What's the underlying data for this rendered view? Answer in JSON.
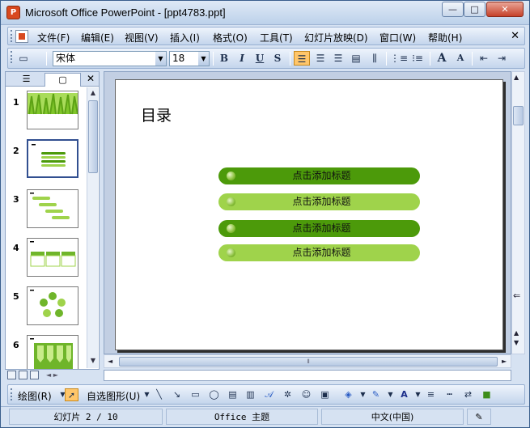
{
  "window": {
    "title": "Microsoft Office PowerPoint - [ppt4783.ppt]",
    "min_glyph": "—",
    "max_glyph": "□",
    "close_glyph": "✕"
  },
  "menu": {
    "items": [
      "文件(F)",
      "编辑(E)",
      "视图(V)",
      "插入(I)",
      "格式(O)",
      "工具(T)",
      "幻灯片放映(D)",
      "窗口(W)",
      "帮助(H)"
    ],
    "close_glyph": "✕"
  },
  "toolbar": {
    "font_name": "宋体",
    "font_size": "18",
    "bold": "B",
    "italic": "I",
    "underline": "U",
    "shadow": "S",
    "grow_font": "A",
    "shrink_font": "A"
  },
  "left_pane": {
    "close_glyph": "✕",
    "slide_numbers": [
      "1",
      "2",
      "3",
      "4",
      "5",
      "6"
    ],
    "selected_slide": 2
  },
  "slide": {
    "title": "目录",
    "items": [
      "点击添加标题",
      "点击添加标题",
      "点击添加标题",
      "点击添加标题"
    ]
  },
  "drawbar": {
    "draw_label": "绘图(R)",
    "autoshapes_label": "自选图形(U)"
  },
  "status": {
    "slide_position": "幻灯片 2 / 10",
    "theme": "Office 主题",
    "language": "中文(中国)"
  },
  "colors": {
    "pill_dark": "#4c9a0a",
    "pill_light": "#9fd34b",
    "accent_active": "#ffc66a"
  }
}
